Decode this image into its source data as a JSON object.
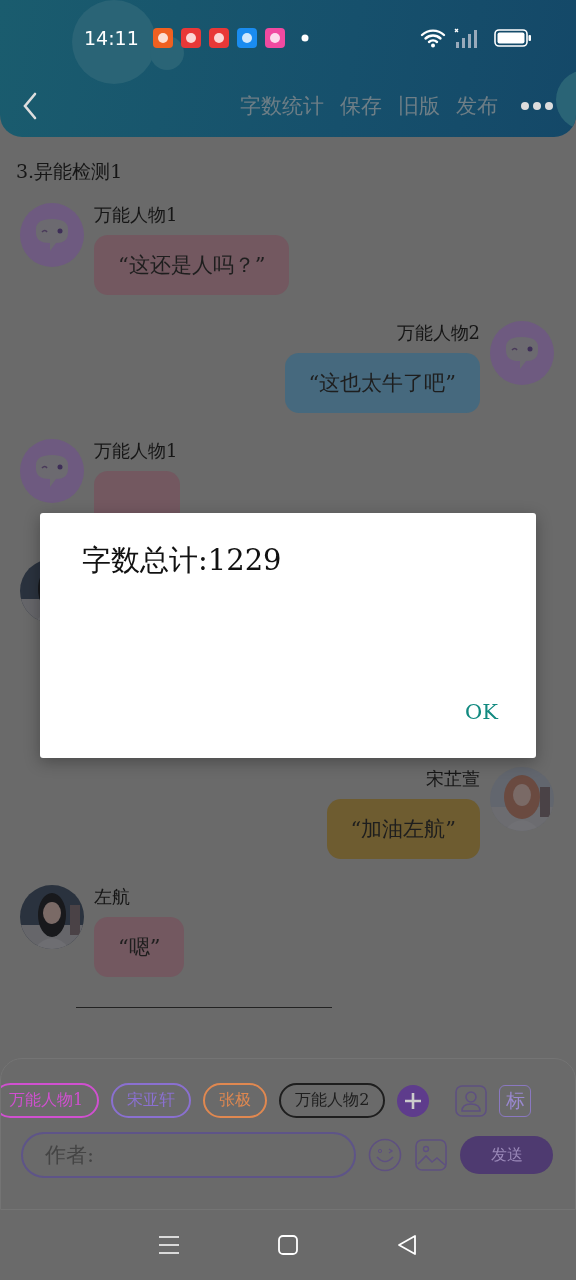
{
  "status_bar": {
    "time": "14:11",
    "app_icons": [
      {
        "color": "#f06020"
      },
      {
        "color": "#e83838"
      },
      {
        "color": "#e83838"
      },
      {
        "color": "#1a8cf0"
      },
      {
        "color": "#f04aa0"
      }
    ]
  },
  "header": {
    "actions": [
      "字数统计",
      "保存",
      "旧版",
      "发布"
    ]
  },
  "chapter_title": "3.异能检测1",
  "messages": [
    {
      "kind": "incoming",
      "avatar": {
        "kind": "icon"
      },
      "name": "万能人物1",
      "text": "“这还是人吗？”",
      "color": "#735860"
    },
    {
      "kind": "outgoing",
      "avatar": {
        "kind": "icon"
      },
      "name": "万能人物2",
      "text": "“这也太牛了吧”",
      "color": "#46697e"
    },
    {
      "kind": "incoming",
      "avatar": {
        "kind": "icon"
      },
      "name": "万能人物1",
      "color": "#735860"
    },
    {
      "kind": "incoming"
    },
    {
      "kind": "outgoing",
      "name": "宋芷萱",
      "text": "“加油左航”",
      "color": "#6e5c30"
    },
    {
      "kind": "incoming",
      "name": "左航",
      "text": "“嗯”",
      "color": "#735860"
    }
  ],
  "characters": [
    {
      "name": "万能人物1",
      "color": "#d050d0"
    },
    {
      "name": "宋亚轩",
      "color": "#8a70d0"
    },
    {
      "name": "张极",
      "color": "#e08850"
    },
    {
      "name": "万能人物2",
      "color": "#1e1e1e"
    }
  ],
  "tag_button": "标",
  "author_field": {
    "placeholder": "作者:"
  },
  "send_button": "发送",
  "dialog": {
    "message": "字数总计:1229",
    "button": "OK"
  }
}
